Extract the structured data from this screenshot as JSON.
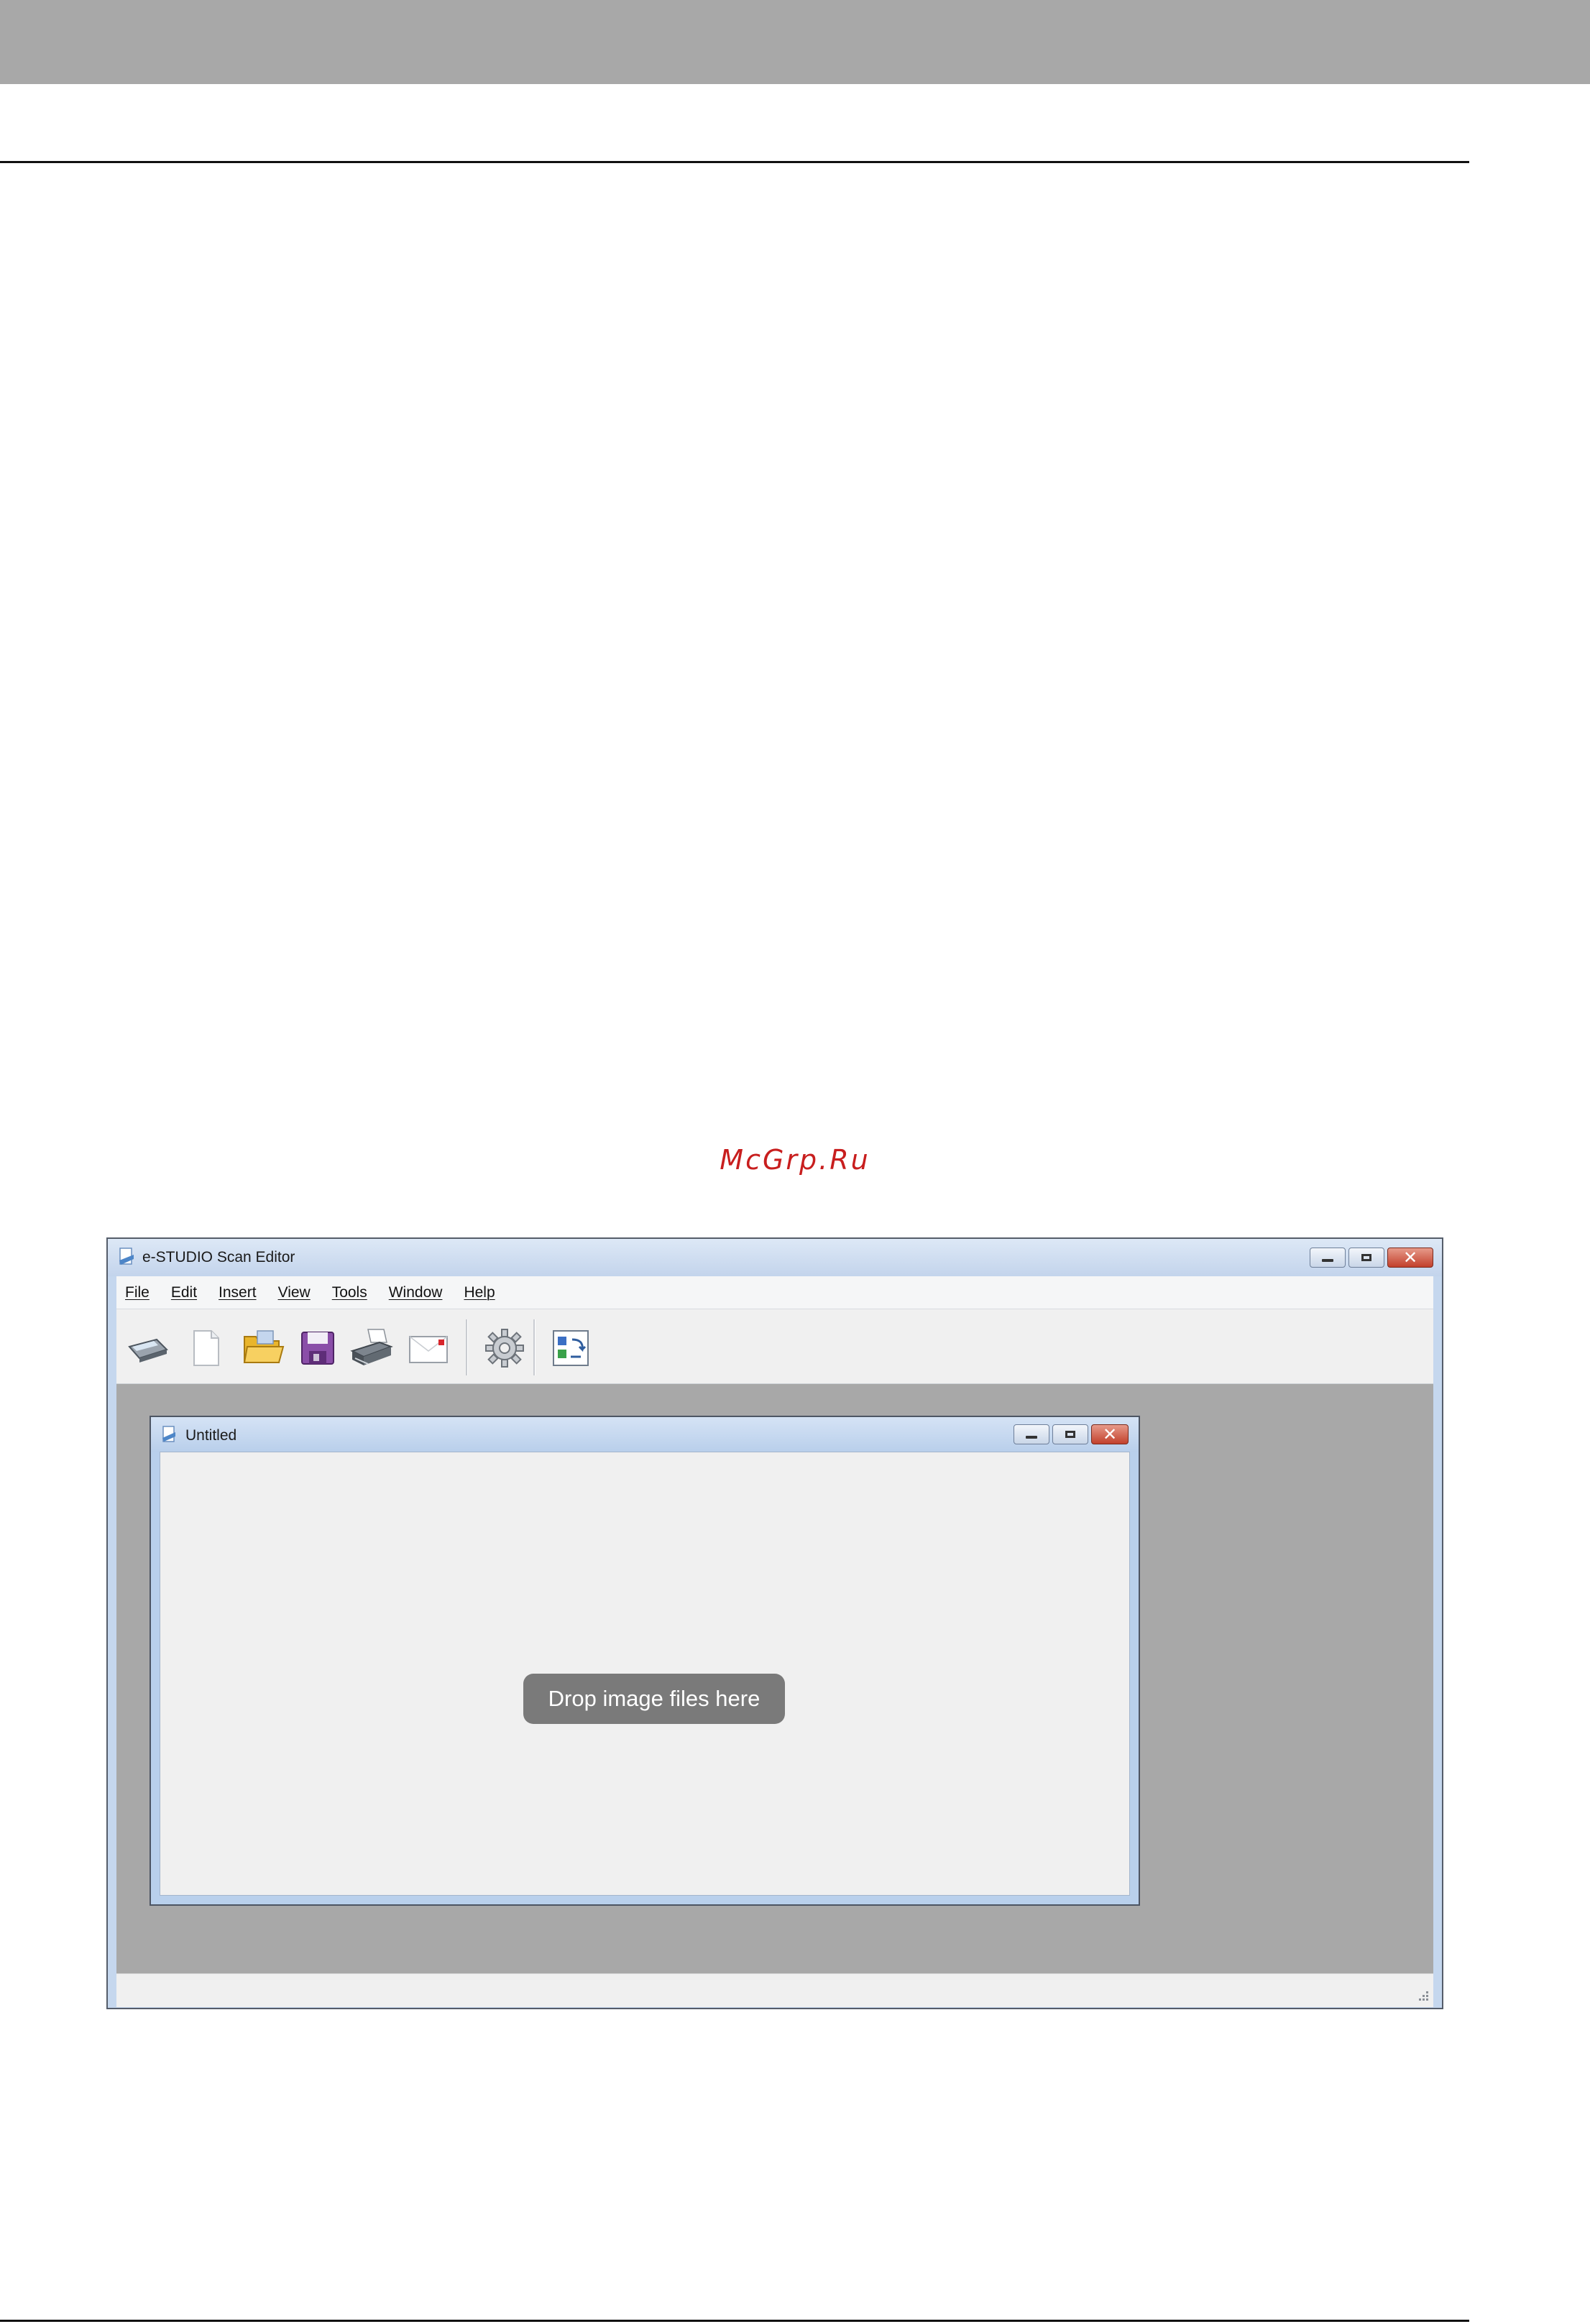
{
  "watermark": "McGrp.Ru",
  "app": {
    "title": "e-STUDIO Scan Editor",
    "menu": [
      "File",
      "Edit",
      "Insert",
      "View",
      "Tools",
      "Window",
      "Help"
    ],
    "toolbar_icons": [
      "scanner-icon",
      "new-document-icon",
      "open-folder-icon",
      "save-disk-icon",
      "printer-icon",
      "email-icon",
      "settings-gear-icon",
      "convert-icon"
    ]
  },
  "document": {
    "title": "Untitled",
    "drop_hint": "Drop image files here"
  },
  "colors": {
    "workspace": "#a8a8a8",
    "close_button": "#c2402c",
    "watermark": "#c81e1e"
  }
}
